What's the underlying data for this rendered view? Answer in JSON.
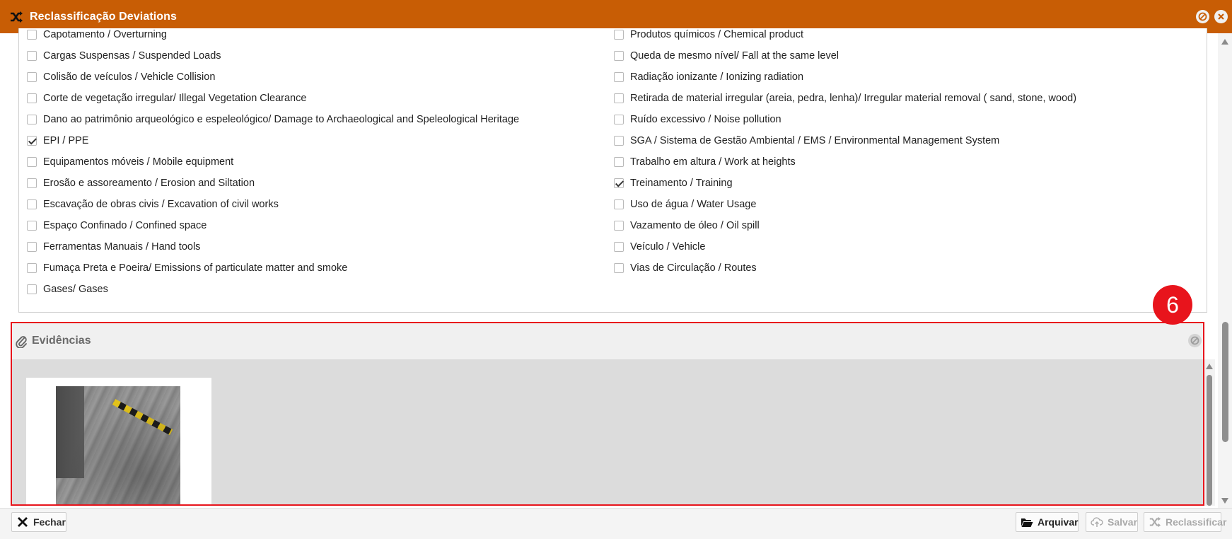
{
  "window": {
    "title": "Reclassificação Deviations",
    "title_icon": "shuffle-icon",
    "controls": [
      "minimize-circle-icon",
      "close-circle-icon"
    ],
    "accent_color": "#c85d05"
  },
  "checklist": {
    "left": [
      {
        "label": "Capotamento / Overturning",
        "checked": false
      },
      {
        "label": "Cargas Suspensas / Suspended Loads",
        "checked": false
      },
      {
        "label": "Colisão de veículos / Vehicle Collision",
        "checked": false
      },
      {
        "label": "Corte de vegetação irregular/ Illegal Vegetation Clearance",
        "checked": false
      },
      {
        "label": "Dano ao patrimônio arqueológico e espeleológico/ Damage to Archaeological and Speleological Heritage",
        "checked": false
      },
      {
        "label": "EPI / PPE",
        "checked": true
      },
      {
        "label": "Equipamentos móveis / Mobile equipment",
        "checked": false
      },
      {
        "label": "Erosão e assoreamento / Erosion and Siltation",
        "checked": false
      },
      {
        "label": "Escavação de obras civis / Excavation of civil works",
        "checked": false
      },
      {
        "label": "Espaço Confinado / Confined space",
        "checked": false
      },
      {
        "label": "Ferramentas Manuais / Hand tools",
        "checked": false
      },
      {
        "label": "Fumaça Preta e Poeira/ Emissions of particulate matter and smoke",
        "checked": false
      },
      {
        "label": "Gases/ Gases",
        "checked": false
      }
    ],
    "right": [
      {
        "label": "Produtos químicos / Chemical product",
        "checked": false
      },
      {
        "label": "Queda de mesmo nível/ Fall at the same level",
        "checked": false
      },
      {
        "label": "Radiação ionizante / Ionizing radiation",
        "checked": false
      },
      {
        "label": "Retirada de material irregular (areia, pedra, lenha)/ Irregular material removal ( sand, stone, wood)",
        "checked": false
      },
      {
        "label": "Ruído excessivo / Noise pollution",
        "checked": false
      },
      {
        "label": "SGA / Sistema de Gestão Ambiental / EMS / Environmental Management System",
        "checked": false
      },
      {
        "label": "Trabalho em altura / Work at heights",
        "checked": false
      },
      {
        "label": "Treinamento / Training",
        "checked": true
      },
      {
        "label": "Uso de água / Water Usage",
        "checked": false
      },
      {
        "label": "Vazamento de óleo / Oil spill",
        "checked": false
      },
      {
        "label": "Veículo / Vehicle",
        "checked": false
      },
      {
        "label": "Vias de Circulação / Routes",
        "checked": false
      }
    ]
  },
  "evidence": {
    "title": "Evidências",
    "icon": "paperclip-icon",
    "close_icon": "close-circle-icon"
  },
  "annotation": {
    "step": "6",
    "color": "#e8141c"
  },
  "footer": {
    "close_label": "Fechar",
    "archive_label": "Arquivar",
    "save_label": "Salvar",
    "reclassify_label": "Reclassificar"
  }
}
